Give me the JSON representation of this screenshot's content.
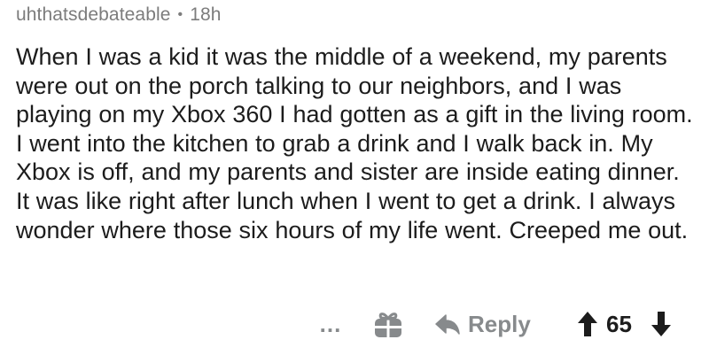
{
  "comment": {
    "username": "uhthatsdebateable",
    "separator": "•",
    "timestamp": "18h",
    "body": "When I was a kid it was the middle of a weekend, my parents were out on the porch talking to our neighbors, and I was playing on my Xbox 360 I had gotten as a gift in the living room. I went into the kitchen to grab a drink and I walk back in. My Xbox is off, and my parents and sister are inside eating dinner. It was like right after lunch when I went to get a drink. I always wonder where those six hours of my life went. Creeped me out."
  },
  "actions": {
    "more_label": "...",
    "more_icon": "more-dots-icon",
    "gift_icon": "gift-icon",
    "reply_icon": "reply-arrow-icon",
    "reply_label": "Reply",
    "upvote_icon": "upvote-arrow-icon",
    "score": "65",
    "downvote_icon": "downvote-arrow-icon"
  },
  "colors": {
    "meta_text": "#7c7c7c",
    "body_text": "#1c1c1c",
    "action_gray": "#878a8c",
    "background": "#ffffff"
  }
}
